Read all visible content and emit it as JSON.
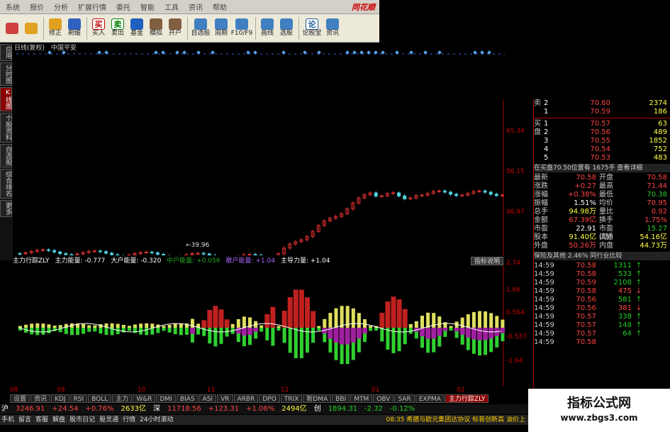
{
  "menubar": {
    "items": [
      "系统",
      "报价",
      "分析",
      "扩展行情",
      "委托",
      "智能",
      "工具",
      "资讯",
      "帮助"
    ],
    "logo": "同花顺"
  },
  "toolbar": [
    {
      "label": "",
      "icon": "layout-icon",
      "color": "#d04040"
    },
    {
      "label": "",
      "icon": "back-arrow-icon",
      "color": "#e0a020"
    },
    {
      "label": "修正",
      "icon": "up-arrow-icon",
      "color": "#e0a020"
    },
    {
      "label": "刷缓",
      "icon": "refresh-icon",
      "color": "#3060c0"
    },
    {
      "label": "买入",
      "icon": "buy-icon",
      "color": "#c00000",
      "glyph": "买"
    },
    {
      "label": "卖出",
      "icon": "sell-icon",
      "color": "#008000",
      "glyph": "卖"
    },
    {
      "label": "基金",
      "icon": "fund-icon",
      "color": "#2060c0"
    },
    {
      "label": "模拟",
      "icon": "hammer-icon",
      "color": "#806040"
    },
    {
      "label": "开户",
      "icon": "person-icon",
      "color": "#806040"
    },
    {
      "label": "自选股",
      "icon": "watchlist-icon",
      "color": "#4080c0"
    },
    {
      "label": "周期",
      "icon": "calendar-icon",
      "color": "#4080c0"
    },
    {
      "label": "F10/F9",
      "icon": "f10-icon",
      "color": "#4080c0"
    },
    {
      "label": "画线",
      "icon": "pen-icon",
      "color": "#4080c0"
    },
    {
      "label": "选股",
      "icon": "select-icon",
      "color": "#4080c0"
    },
    {
      "label": "论股堂",
      "icon": "forum-icon",
      "color": "#2060a0",
      "glyph": "论"
    },
    {
      "label": "资讯",
      "icon": "news-icon",
      "color": "#4080c0"
    }
  ],
  "left_tabs": [
    "应用",
    "分时图",
    "K线图",
    "个股资料",
    "自选股",
    "综合排名",
    "更多"
  ],
  "chart": {
    "title": "日线(复权)",
    "stock": "中国平安",
    "low_label": "39.96",
    "price_axis": [
      "65.34",
      "56.15",
      "46.97"
    ],
    "ind_axis": [
      "2.74",
      "1.66",
      "0.564",
      "-0.537",
      "-1.64"
    ],
    "months": [
      "08",
      "09",
      "10",
      "11",
      "12",
      "01",
      "02"
    ]
  },
  "indicator": {
    "name": "主力行踪ZLY",
    "f1": "主力能量: -0.777",
    "f2": "大户能量: -0.320",
    "f3": "中户能量: +0.056",
    "f4": "散户能量: +1.04",
    "f5": "主导力量: +1.04",
    "explain": "指标说明"
  },
  "quote": {
    "sell": [
      {
        "lvl": "2",
        "price": "70.60",
        "vol": "2374"
      },
      {
        "lvl": "1",
        "price": "70.59",
        "vol": "186"
      }
    ],
    "buy": [
      {
        "lvl": "1",
        "price": "70.57",
        "vol": "63"
      },
      {
        "lvl": "2",
        "price": "70.56",
        "vol": "489"
      },
      {
        "lvl": "3",
        "price": "70.55",
        "vol": "1852"
      },
      {
        "lvl": "4",
        "price": "70.54",
        "vol": "752"
      },
      {
        "lvl": "5",
        "price": "70.53",
        "vol": "483"
      }
    ],
    "sell_label": "卖",
    "buy_label": "买盘",
    "info_bar": "在买盘70.50位置有 1675手 查看详细",
    "stats": [
      {
        "k": "最新",
        "v": "70.58",
        "k2": "开盘",
        "v2": "70.58"
      },
      {
        "k": "涨跌",
        "v": "+0.27",
        "k2": "最高",
        "v2": "71.44"
      },
      {
        "k": "涨幅",
        "v": "+0.38%",
        "k2": "最低",
        "v2": "70.38"
      },
      {
        "k": "振幅",
        "v": "1.51%",
        "k2": "均价",
        "v2": "70.95"
      },
      {
        "k": "总手",
        "v": "94.98万",
        "k2": "量比",
        "v2": "0.92"
      },
      {
        "k": "金额",
        "v": "67.39亿",
        "k2": "换手",
        "v2": "1.75%"
      },
      {
        "k": "市盈",
        "v": "22.91",
        "k2": "市盈(动)",
        "v2": "15.27"
      },
      {
        "k": "股本",
        "v": "91.40亿",
        "k2": "流通",
        "v2": "54.16亿"
      },
      {
        "k": "外盘",
        "v": "50.26万",
        "k2": "内盘",
        "v2": "44.73万"
      }
    ],
    "sector_bar": "保险及其他 2.46% 同行业比较",
    "ticks": [
      {
        "t": "14:59",
        "p": "70.58",
        "v": "1311",
        "up": true
      },
      {
        "t": "14:59",
        "p": "70.58",
        "v": "533",
        "up": true
      },
      {
        "t": "14:59",
        "p": "70.59",
        "v": "2108",
        "up": true
      },
      {
        "t": "14:59",
        "p": "70.58",
        "v": "475",
        "up": false
      },
      {
        "t": "14:59",
        "p": "70.56",
        "v": "581",
        "up": true
      },
      {
        "t": "14:59",
        "p": "70.56",
        "v": "381",
        "up": false
      },
      {
        "t": "14:59",
        "p": "70.57",
        "v": "338",
        "up": true
      },
      {
        "t": "14:59",
        "p": "70.57",
        "v": "148",
        "up": true
      },
      {
        "t": "14:59",
        "p": "70.57",
        "v": "64",
        "up": true
      },
      {
        "t": "14:59",
        "p": "70.58",
        "v": "",
        "up": true
      }
    ]
  },
  "bottom_tabs": [
    "设置",
    "资讯",
    "KDJ",
    "RSI",
    "BOLL",
    "主力",
    "W&R",
    "DMI",
    "BIAS",
    "ASI",
    "VR",
    "ARBR",
    "DPO",
    "TRIX",
    "新DMA",
    "BBI",
    "MTM",
    "OBV",
    "SAR",
    "EXPMA",
    "主力行踪ZLY"
  ],
  "status": {
    "sh_label": "沪",
    "sh_idx": "3246.91",
    "sh_chg": "+24.54",
    "sh_pct": "+0.76%",
    "sh_amt": "2633亿",
    "sz_label": "深",
    "sz_idx": "11718.56",
    "sz_chg": "+123.31",
    "sz_pct": "+1.06%",
    "sz_amt": "2494亿",
    "cy_label": "创",
    "cy_idx": "1894.31",
    "cy_chg": "-2.32",
    "cy_pct": "-0.12%"
  },
  "bottom_menu": [
    "手机",
    "留言",
    "客服",
    "解盘",
    "股市日记",
    "股灵通",
    "行情",
    "24小时滚动"
  ],
  "news": "08:35 希腊与欧元集团达协议  标普创新高  油价上",
  "watermark": {
    "line1": "指标公式网",
    "line2": "www.zbgs3.com"
  }
}
